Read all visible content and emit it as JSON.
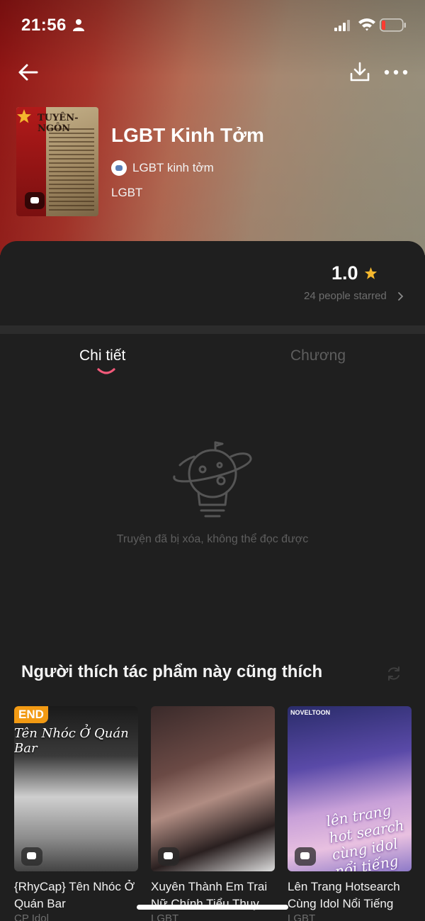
{
  "status_bar": {
    "time": "21:56"
  },
  "book": {
    "cover_text": "TUYÊN-NGÔN",
    "title": "LGBT Kinh Tởm",
    "author": "LGBT kinh tởm",
    "genre": "LGBT"
  },
  "rating": {
    "value": "1.0",
    "starred_text": "24 people starred"
  },
  "tabs": [
    {
      "label": "Chi tiết",
      "active": true
    },
    {
      "label": "Chương",
      "active": false
    }
  ],
  "empty_state": {
    "message": "Truyện đã bị xóa, không thể đọc được"
  },
  "recommendations": {
    "title": "Người thích tác phẩm này cũng thích",
    "items": [
      {
        "badge": "END",
        "cover_text": "Tên Nhóc Ở Quán Bar",
        "title": "{RhyCap} Tên Nhóc Ở Quán Bar",
        "genre": "CP Idol"
      },
      {
        "badge": "",
        "cover_text": "",
        "title": "Xuyên Thành Em Trai Nữ Chính Tiểu Thuy...",
        "genre": "LGBT"
      },
      {
        "badge": "",
        "brand": "NOVELTOON",
        "cover_text": "lên trang hot search cùng idol nổi tiếng",
        "title": "Lên Trang Hotsearch Cùng Idol Nổi Tiếng",
        "genre": "LGBT"
      }
    ]
  },
  "colors": {
    "accent": "#f25a7a",
    "star": "#f5b82e",
    "badge": "#f29a13",
    "panel_bg": "#1f1f1f"
  },
  "icons": [
    "person-icon",
    "signal-icon",
    "wifi-icon",
    "battery-icon",
    "back-icon",
    "download-icon",
    "more-icon",
    "star-icon",
    "chevron-right-icon",
    "lightbulb-planet-icon",
    "refresh-icon",
    "chat-icon"
  ]
}
